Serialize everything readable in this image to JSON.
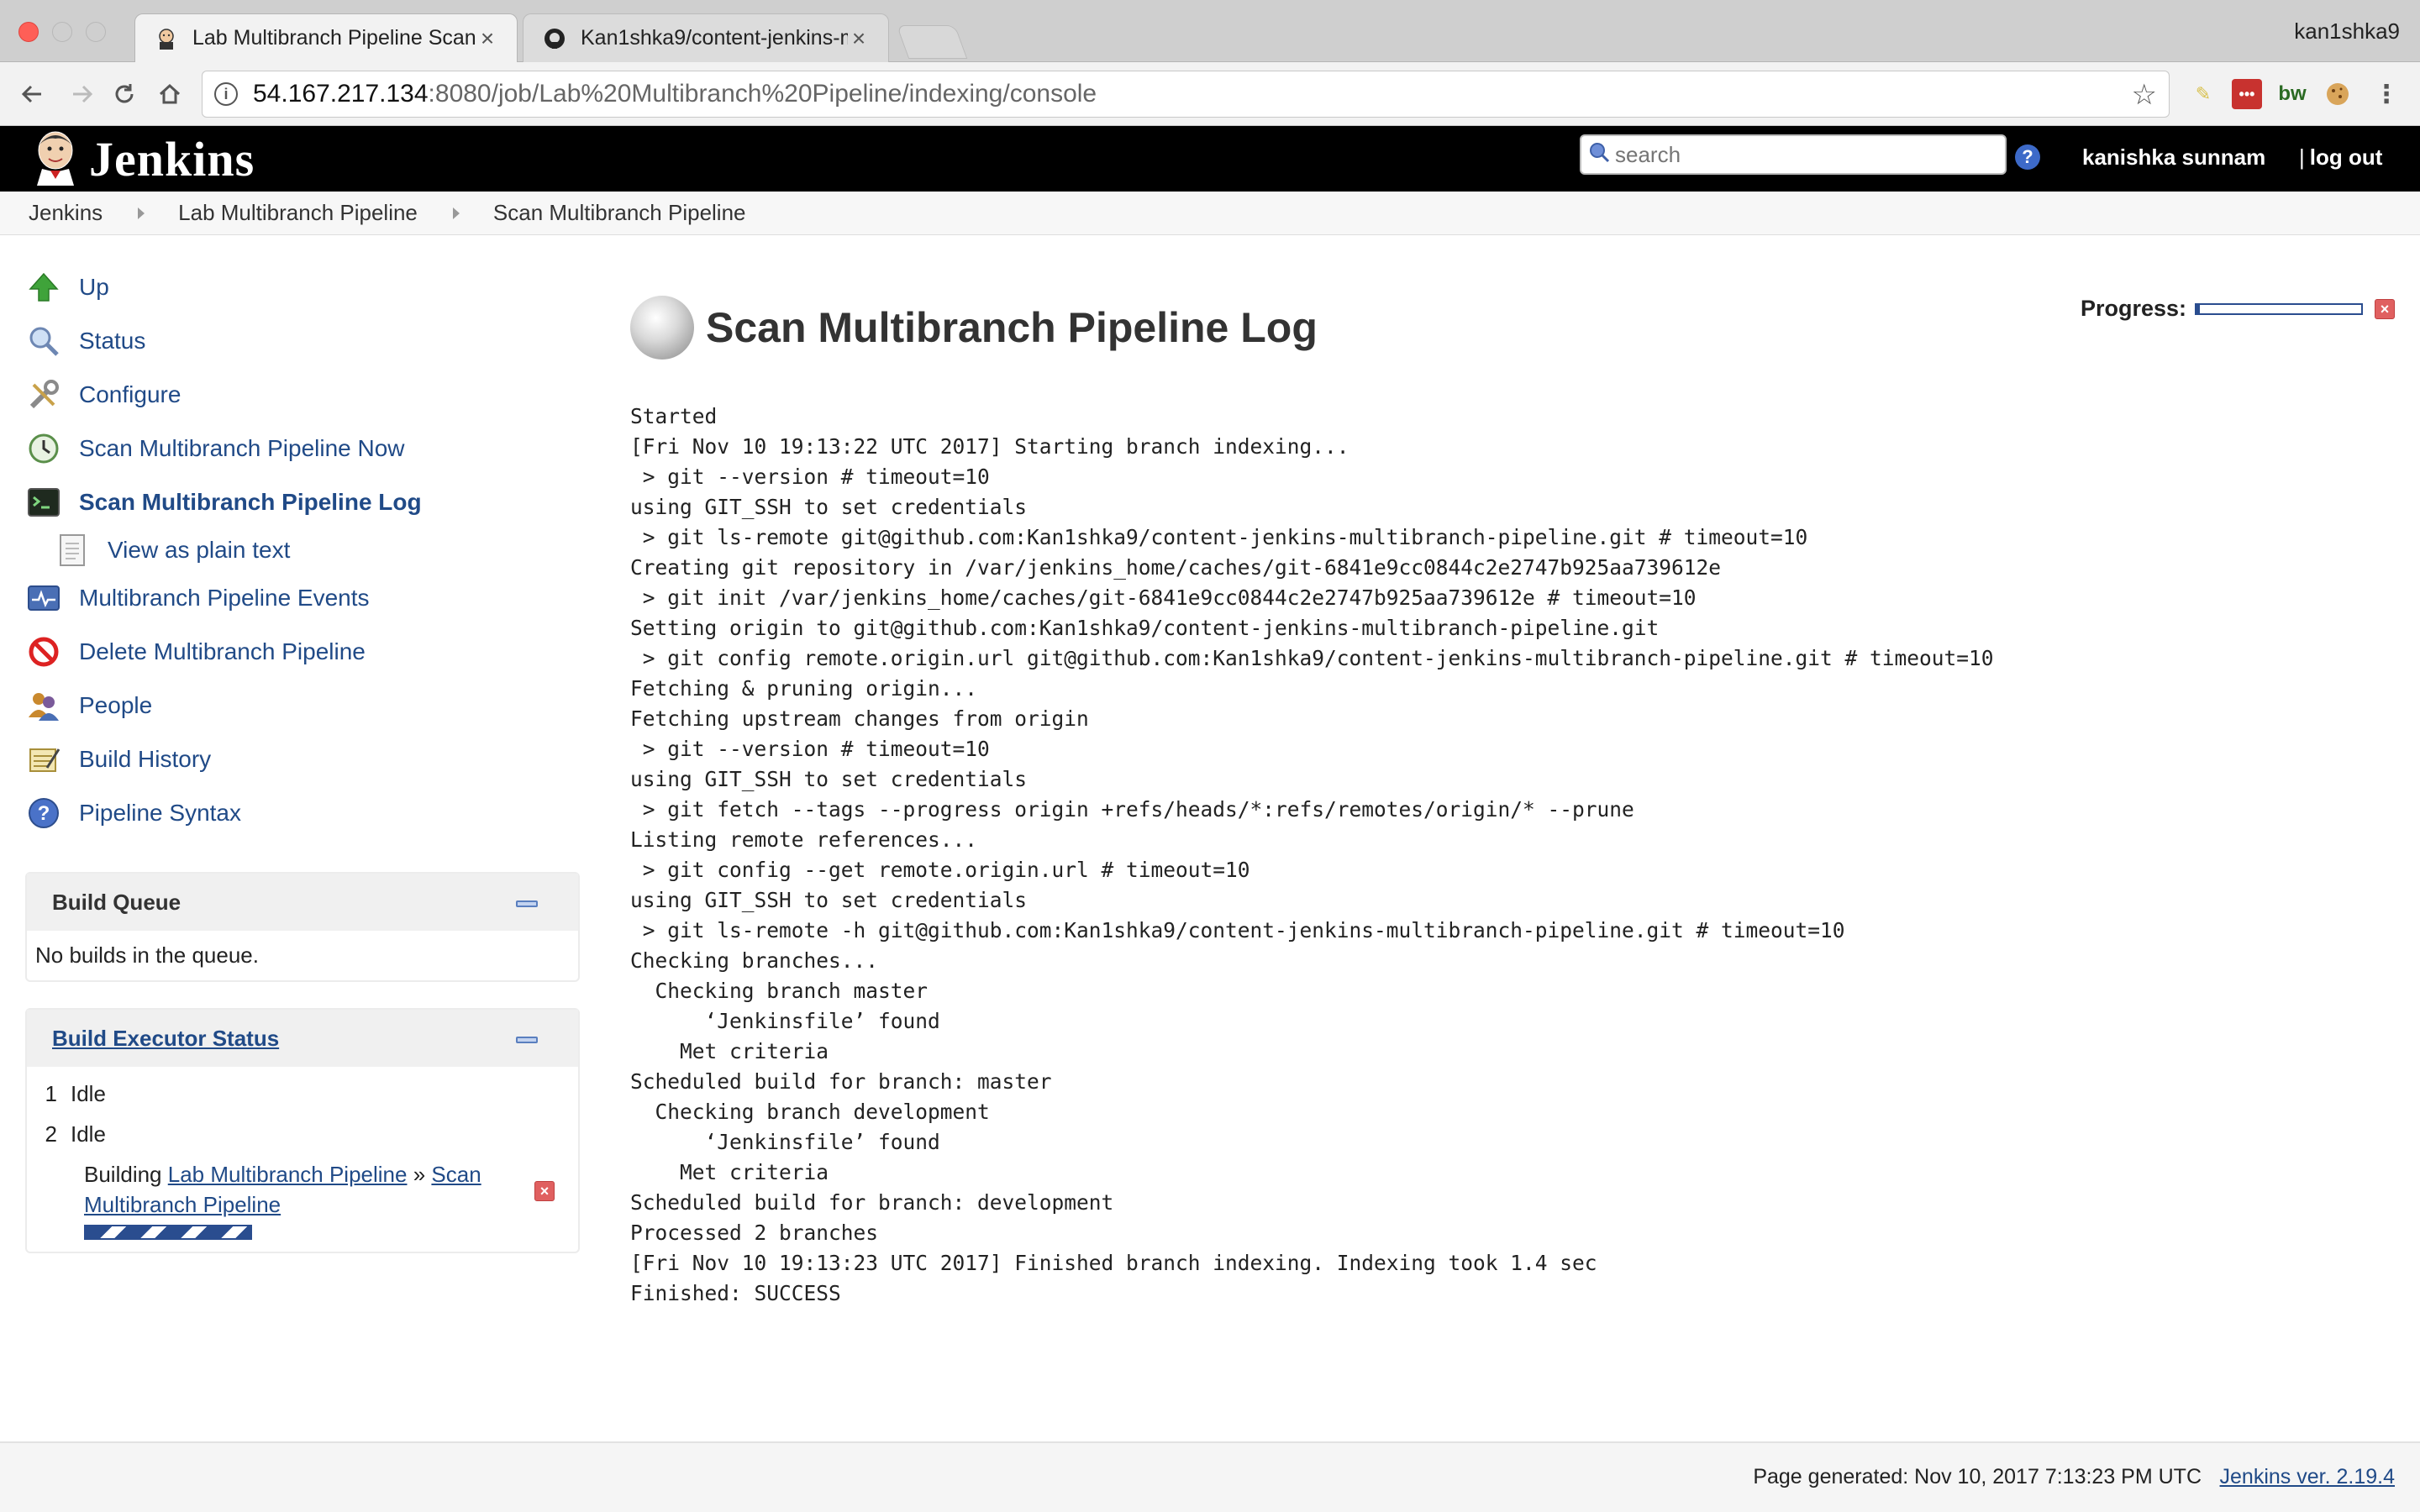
{
  "browser": {
    "tabs": [
      {
        "title": "Lab Multibranch Pipeline Scan",
        "active": true
      },
      {
        "title": "Kan1shka9/content-jenkins-m",
        "active": false
      }
    ],
    "profile_name": "kan1shka9",
    "url_host": "54.167.217.134",
    "url_rest": ":8080/job/Lab%20Multibranch%20Pipeline/indexing/console",
    "extensions": [
      "notes-icon",
      "lastpass-icon",
      "bw-icon",
      "cookie-icon"
    ],
    "ext_bw_label": "bw"
  },
  "header": {
    "logo_text": "Jenkins",
    "search_placeholder": "search",
    "help_glyph": "?",
    "user_name": "kanishka sunnam",
    "logout_label": "log out",
    "logout_separator": "|"
  },
  "breadcrumbs": [
    "Jenkins",
    "Lab Multibranch Pipeline",
    "Scan Multibranch Pipeline"
  ],
  "side": {
    "tasks": [
      {
        "label": "Up",
        "icon": "up-arrow-icon"
      },
      {
        "label": "Status",
        "icon": "magnifier-icon"
      },
      {
        "label": "Configure",
        "icon": "wrench-icon"
      },
      {
        "label": "Scan Multibranch Pipeline Now",
        "icon": "clock-icon"
      },
      {
        "label": "Scan Multibranch Pipeline Log",
        "icon": "terminal-icon"
      },
      {
        "label": "View as plain text",
        "icon": "document-icon"
      },
      {
        "label": "Multibranch Pipeline Events",
        "icon": "pulse-icon"
      },
      {
        "label": "Delete Multibranch Pipeline",
        "icon": "no-entry-icon"
      },
      {
        "label": "People",
        "icon": "people-icon"
      },
      {
        "label": "Build History",
        "icon": "notepad-icon"
      },
      {
        "label": "Pipeline Syntax",
        "icon": "help-icon"
      }
    ],
    "build_queue": {
      "title": "Build Queue",
      "empty_text": "No builds in the queue."
    },
    "executors": {
      "title": "Build Executor Status",
      "rows": [
        {
          "num": "1",
          "state": "Idle"
        },
        {
          "num": "2",
          "state": "Idle"
        }
      ],
      "building_prefix": "Building",
      "building_job": "Lab Multibranch Pipeline",
      "building_sep": "»",
      "building_sub": "Scan Multibranch Pipeline",
      "stop_glyph": "×"
    }
  },
  "main": {
    "title": "Scan Multibranch Pipeline Log",
    "progress_label": "Progress:",
    "progress_fraction": 0.02,
    "console_lines": [
      "Started",
      "[Fri Nov 10 19:13:22 UTC 2017] Starting branch indexing...",
      " > git --version # timeout=10",
      "using GIT_SSH to set credentials",
      " > git ls-remote git@github.com:Kan1shka9/content-jenkins-multibranch-pipeline.git # timeout=10",
      "Creating git repository in /var/jenkins_home/caches/git-6841e9cc0844c2e2747b925aa739612e",
      " > git init /var/jenkins_home/caches/git-6841e9cc0844c2e2747b925aa739612e # timeout=10",
      "Setting origin to git@github.com:Kan1shka9/content-jenkins-multibranch-pipeline.git",
      " > git config remote.origin.url git@github.com:Kan1shka9/content-jenkins-multibranch-pipeline.git # timeout=10",
      "Fetching & pruning origin...",
      "Fetching upstream changes from origin",
      " > git --version # timeout=10",
      "using GIT_SSH to set credentials",
      " > git fetch --tags --progress origin +refs/heads/*:refs/remotes/origin/* --prune",
      "Listing remote references...",
      " > git config --get remote.origin.url # timeout=10",
      "using GIT_SSH to set credentials",
      " > git ls-remote -h git@github.com:Kan1shka9/content-jenkins-multibranch-pipeline.git # timeout=10",
      "Checking branches...",
      "  Checking branch master",
      "      ‘Jenkinsfile’ found",
      "    Met criteria",
      "Scheduled build for branch: master",
      "  Checking branch development",
      "      ‘Jenkinsfile’ found",
      "    Met criteria",
      "Scheduled build for branch: development",
      "Processed 2 branches",
      "[Fri Nov 10 19:13:23 UTC 2017] Finished branch indexing. Indexing took 1.4 sec",
      "Finished: SUCCESS"
    ]
  },
  "footer": {
    "page_generated": "Page generated: Nov 10, 2017 7:13:23 PM UTC",
    "jenkins_version": "Jenkins ver. 2.19.4"
  }
}
